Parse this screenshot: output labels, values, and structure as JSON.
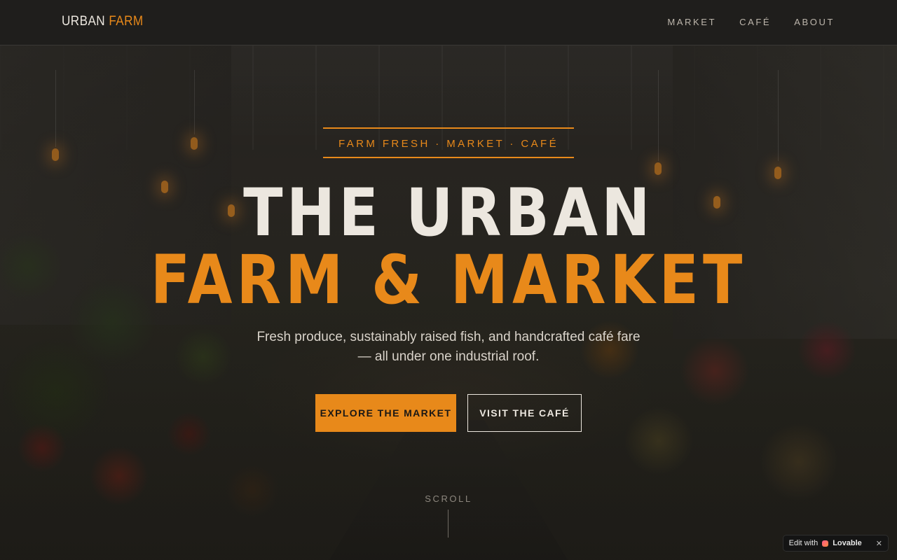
{
  "nav": {
    "logo_word1": "URBAN",
    "logo_word2": "FARM",
    "items": [
      {
        "label": "MARKET"
      },
      {
        "label": "CAFÉ"
      },
      {
        "label": "ABOUT"
      }
    ]
  },
  "hero": {
    "tagline": "FARM FRESH · MARKET · CAFÉ",
    "title_line1": "THE URBAN",
    "title_line2": "FARM & MARKET",
    "subtitle_line1": "Fresh produce, sustainably raised fish, and handcrafted café fare",
    "subtitle_line2": "— all under one industrial roof.",
    "primary_button": "EXPLORE THE MARKET",
    "secondary_button": "VISIT THE CAFÉ",
    "scroll_label": "SCROLL"
  },
  "badge": {
    "prefix": "Edit with",
    "brand": "Lovable",
    "close": "✕"
  },
  "colors": {
    "accent": "#e8891a",
    "background": "#1f1e1c",
    "text": "#ece7df"
  }
}
